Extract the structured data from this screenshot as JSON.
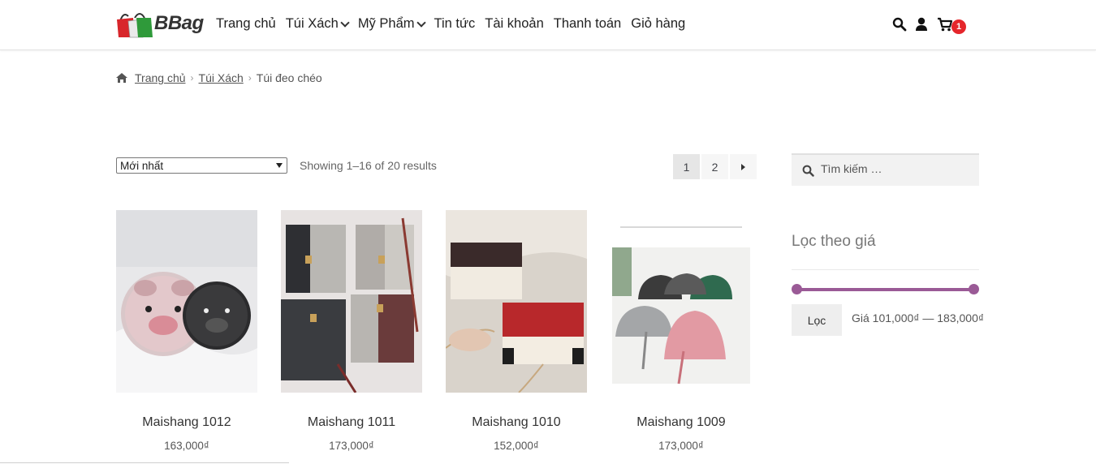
{
  "header": {
    "logo_text": "BBag",
    "nav": [
      {
        "label": "Trang chủ",
        "has_dropdown": false
      },
      {
        "label": "Túi Xách",
        "has_dropdown": true
      },
      {
        "label": "Mỹ Phẩm",
        "has_dropdown": true
      },
      {
        "label": "Tin tức",
        "has_dropdown": false
      },
      {
        "label": "Tài khoản",
        "has_dropdown": false
      },
      {
        "label": "Thanh toán",
        "has_dropdown": false
      },
      {
        "label": "Giỏ hàng",
        "has_dropdown": false
      }
    ],
    "icons": [
      "search-icon",
      "user-icon",
      "cart-icon"
    ],
    "cart_count": "1"
  },
  "breadcrumb": {
    "items": [
      {
        "label": "Trang chủ",
        "link": true
      },
      {
        "label": "Túi Xách",
        "link": true
      },
      {
        "label": "Túi đeo chéo",
        "link": false
      }
    ]
  },
  "toolbar": {
    "sort_selected": "Mới nhất",
    "result_count": "Showing 1–16 of 20 results",
    "pages": [
      "1",
      "2"
    ],
    "current_page": "1"
  },
  "products": [
    {
      "name": "Maishang 1012",
      "price": "163,000₫"
    },
    {
      "name": "Maishang 1011",
      "price": "173,000₫"
    },
    {
      "name": "Maishang 1010",
      "price": "152,000₫"
    },
    {
      "name": "Maishang 1009",
      "price": "173,000₫"
    }
  ],
  "sidebar": {
    "search_placeholder": "Tìm kiếm …",
    "filter_title": "Lọc theo giá",
    "filter_button": "Lọc",
    "price_label": "Giá",
    "price_min": "101,000₫",
    "price_max": "183,000₫",
    "price_range_text": "Giá 101,000₫ — 183,000₫"
  },
  "colors": {
    "accent": "#9a5a96",
    "badge": "#e5262b"
  }
}
